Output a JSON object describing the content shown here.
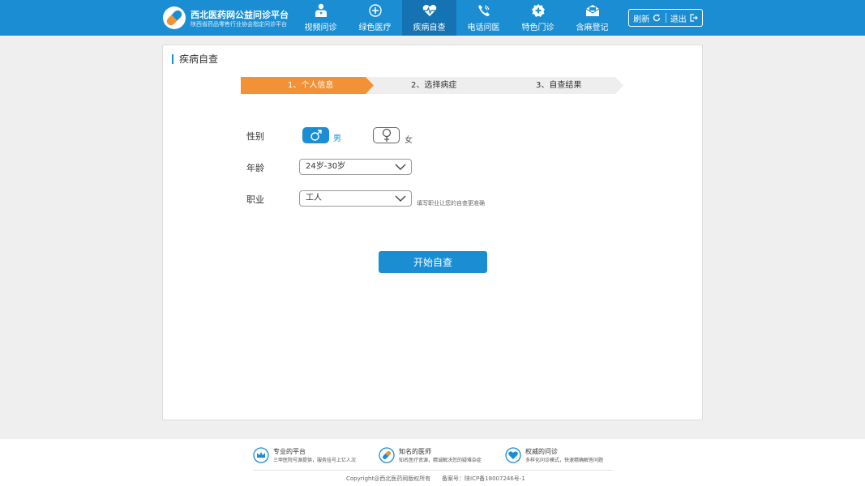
{
  "brand": {
    "title": "西北医药网公益问诊平台",
    "subtitle": "陕西省药品零售行业协会指定问诊平台"
  },
  "nav": [
    {
      "label": "视频问诊",
      "icon": "video-doctor-icon"
    },
    {
      "label": "绿色医疗",
      "icon": "plus-circle-icon"
    },
    {
      "label": "疾病自查",
      "icon": "heart-pulse-icon"
    },
    {
      "label": "电话问医",
      "icon": "phone-icon"
    },
    {
      "label": "特色门诊",
      "icon": "cross-badge-icon"
    },
    {
      "label": "含麻登记",
      "icon": "mail-icon"
    }
  ],
  "header_buttons": {
    "refresh": "刷新",
    "logout": "退出"
  },
  "panel": {
    "title": "疾病自查",
    "steps": [
      "1、个人信息",
      "2、选择病症",
      "3、自查结果"
    ],
    "active_step": 1
  },
  "form": {
    "sex_label": "性别",
    "male": "男",
    "female": "女",
    "age_label": "年龄",
    "age_value": "24岁-30岁",
    "job_label": "职业",
    "job_value": "工人",
    "job_hint": "填写职业让您的自查更准确",
    "start_button": "开始自查"
  },
  "footer": {
    "features": [
      {
        "title": "专业的平台",
        "desc": "三甲医院号源提供，服务挂号上亿人次",
        "icon": "crown-icon"
      },
      {
        "title": "知名的医师",
        "desc": "知名医疗资源，精诚解决您的疑难杂症",
        "icon": "pill-icon"
      },
      {
        "title": "权威的问诊",
        "desc": "多样化问诊模式，快速精确解答问题",
        "icon": "heart-hand-icon"
      }
    ],
    "copyright": "Copyright@西北医药网版权所有",
    "icp": "备案号：陕ICP备18007246号-1"
  },
  "colors": {
    "primary": "#1b8ed3",
    "active_nav": "#1573b3",
    "step_active": "#f39136",
    "step_inactive": "#eeeeee"
  }
}
